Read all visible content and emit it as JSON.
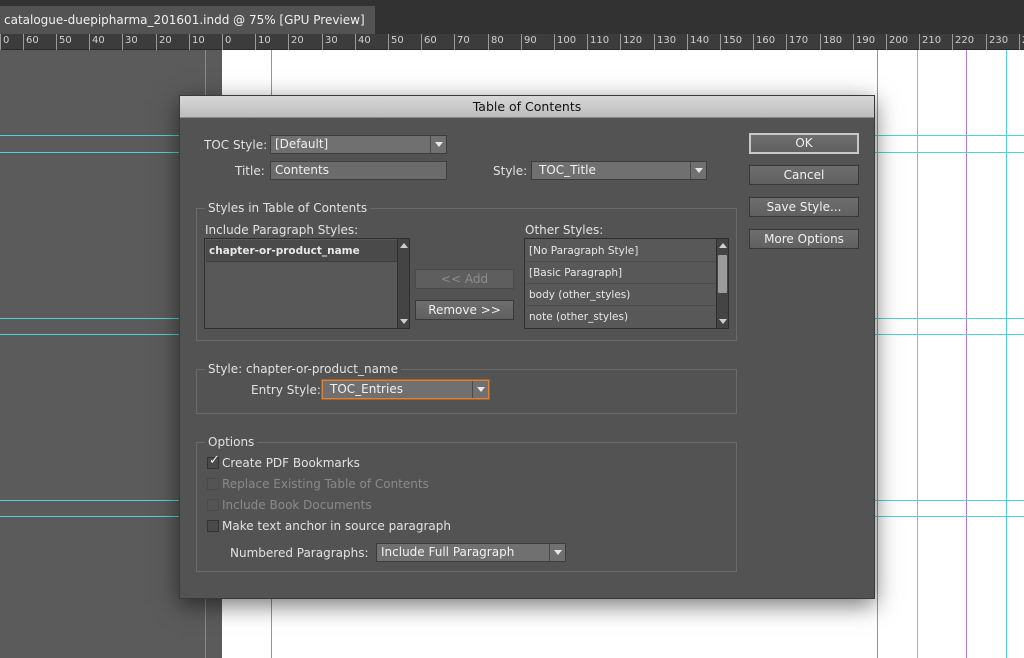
{
  "app": {
    "doc_tab": "catalogue-duepipharma_201601.indd @ 75% [GPU Preview]",
    "ruler_labels": [
      "0",
      "60",
      "50",
      "40",
      "30",
      "20",
      "10",
      "0",
      "10",
      "20",
      "30",
      "40",
      "50",
      "60",
      "70",
      "80",
      "90",
      "100",
      "110",
      "120",
      "130",
      "140",
      "150",
      "160",
      "170",
      "180",
      "190",
      "200",
      "210",
      "220",
      "230",
      "2"
    ]
  },
  "dialog": {
    "title": "Table of Contents",
    "toc_style_label": "TOC Style:",
    "toc_style_value": "[Default]",
    "title_label": "Title:",
    "title_value": "Contents",
    "style_label": "Style:",
    "style_value": "TOC_Title",
    "buttons": {
      "ok": "OK",
      "cancel": "Cancel",
      "save_style": "Save Style...",
      "more_options": "More Options",
      "add": "<< Add",
      "remove": "Remove >>"
    },
    "styles_group": {
      "legend": "Styles in Table of Contents",
      "include_label": "Include Paragraph Styles:",
      "include_items": [
        "chapter-or-product_name"
      ],
      "other_label": "Other Styles:",
      "other_items": [
        "[No Paragraph Style]",
        "[Basic Paragraph]",
        "body (other_styles)",
        "note (other_styles)"
      ]
    },
    "style_group": {
      "legend": "Style: chapter-or-product_name",
      "entry_style_label": "Entry Style:",
      "entry_style_value": "TOC_Entries"
    },
    "options_group": {
      "legend": "Options",
      "checkboxes": [
        {
          "label": "Create PDF Bookmarks",
          "checked": true,
          "enabled": true
        },
        {
          "label": "Replace Existing Table of Contents",
          "checked": false,
          "enabled": false
        },
        {
          "label": "Include Book Documents",
          "checked": false,
          "enabled": false
        },
        {
          "label": "Make text anchor in source paragraph",
          "checked": false,
          "enabled": true
        }
      ],
      "numbered_label": "Numbered Paragraphs:",
      "numbered_value": "Include Full Paragraph"
    }
  },
  "colors": {
    "guide_cyan": "#4fd2da",
    "guide_purple": "#b07ae0",
    "focus_orange": "#d7843f"
  }
}
